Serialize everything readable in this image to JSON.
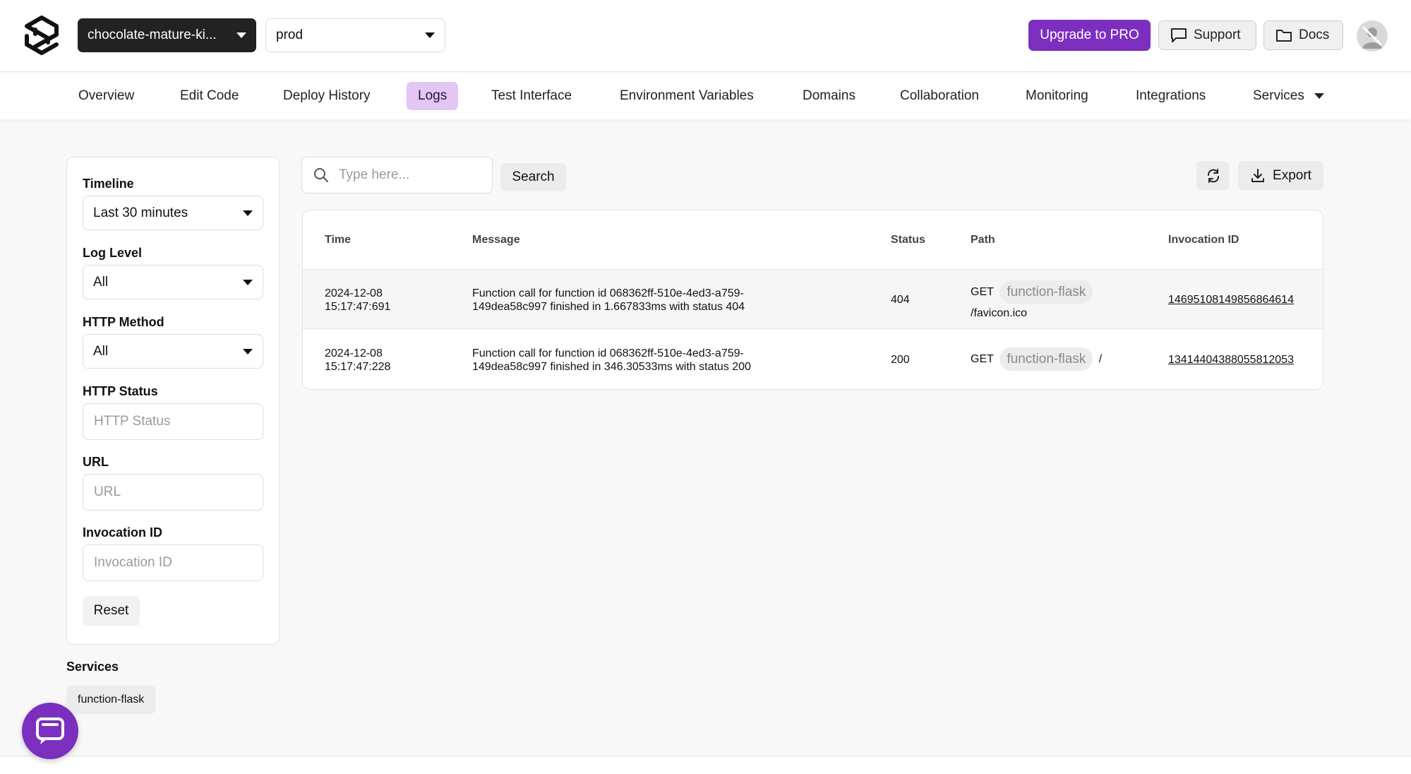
{
  "header": {
    "project_name": "chocolate-mature-ki...",
    "environment": "prod",
    "upgrade_label": "Upgrade to PRO",
    "support_label": "Support",
    "docs_label": "Docs"
  },
  "nav": {
    "items": [
      {
        "label": "Overview"
      },
      {
        "label": "Edit Code"
      },
      {
        "label": "Deploy History"
      },
      {
        "label": "Logs",
        "active": true
      },
      {
        "label": "Test Interface"
      },
      {
        "label": "Environment Variables"
      },
      {
        "label": "Domains"
      },
      {
        "label": "Collaboration"
      },
      {
        "label": "Monitoring"
      },
      {
        "label": "Integrations"
      },
      {
        "label": "Services"
      }
    ]
  },
  "filters": {
    "timeline": {
      "label": "Timeline",
      "value": "Last 30 minutes"
    },
    "log_level": {
      "label": "Log Level",
      "value": "All"
    },
    "http_method": {
      "label": "HTTP Method",
      "value": "All"
    },
    "http_status": {
      "label": "HTTP Status",
      "placeholder": "HTTP Status"
    },
    "url": {
      "label": "URL",
      "placeholder": "URL"
    },
    "invocation_id": {
      "label": "Invocation ID",
      "placeholder": "Invocation ID"
    },
    "reset_label": "Reset"
  },
  "services": {
    "label": "Services",
    "items": [
      "function-flask"
    ]
  },
  "search": {
    "placeholder": "Type here...",
    "button_label": "Search"
  },
  "toolbar": {
    "export_label": "Export"
  },
  "table": {
    "columns": [
      "Time",
      "Message",
      "Status",
      "Path",
      "Invocation ID"
    ],
    "rows": [
      {
        "time_date": "2024-12-08",
        "time_clock": "15:17:47:691",
        "message_line1": "Function call for function id 068362ff-510e-4ed3-a759-",
        "message_line2": "149dea58c997 finished in 1.667833ms with status 404",
        "status": "404",
        "method": "GET",
        "service": "function-flask",
        "path": "/favicon.ico",
        "invocation_id": "14695108149856864614"
      },
      {
        "time_date": "2024-12-08",
        "time_clock": "15:17:47:228",
        "message_line1": "Function call for function id 068362ff-510e-4ed3-a759-",
        "message_line2": "149dea58c997 finished in 346.30533ms with status 200",
        "status": "200",
        "method": "GET",
        "service": "function-flask",
        "path": "/",
        "invocation_id": "13414404388055812053"
      }
    ]
  },
  "colors": {
    "brand_purple": "#7c2fbf",
    "active_tab": "#e2c6f4"
  }
}
